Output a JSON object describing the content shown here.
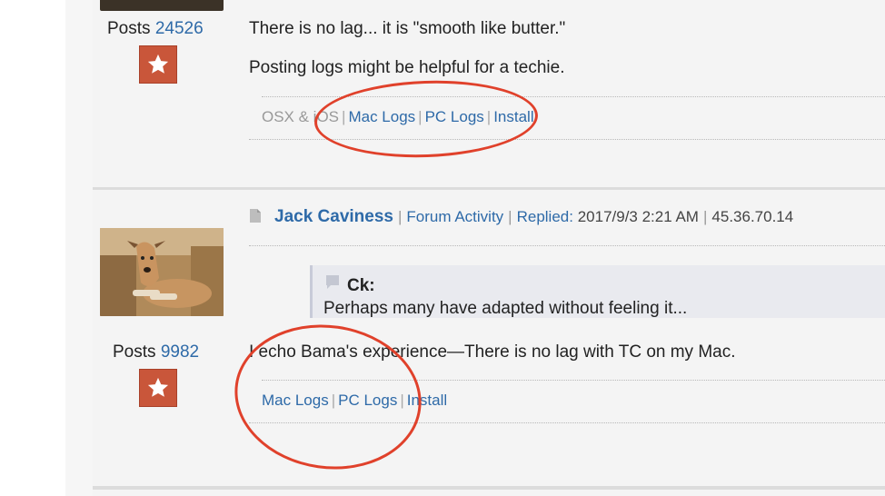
{
  "post1": {
    "posts_label": "Posts",
    "posts_count": "24526",
    "line1": "There is no lag... it is \"smooth like butter.\"",
    "line2": "Posting logs might be helpful for a techie.",
    "os_label": "OSX & iOS",
    "mac_logs": "Mac Logs",
    "pc_logs": "PC Logs",
    "install": "Install"
  },
  "post2": {
    "author": "Jack Caviness",
    "forum_activity": "Forum Activity",
    "replied_label": "Replied:",
    "replied_date": "2017/9/3 2:21 AM",
    "ip": "45.36.70.14",
    "quote_author": "Ck:",
    "quote_text": "Perhaps many have adapted without feeling it...",
    "body": "I echo Bama's experience—There is no lag with TC on my Mac.",
    "posts_label": "Posts",
    "posts_count": "9982",
    "mac_logs": "Mac Logs",
    "pc_logs": "PC Logs",
    "install": "Install"
  },
  "icons": {
    "rank": "star-badge-icon",
    "post": "document-icon",
    "quote": "quote-icon"
  },
  "colors": {
    "link": "#2e6aa8",
    "badge": "#c9563a",
    "annotation": "#e0412b"
  }
}
